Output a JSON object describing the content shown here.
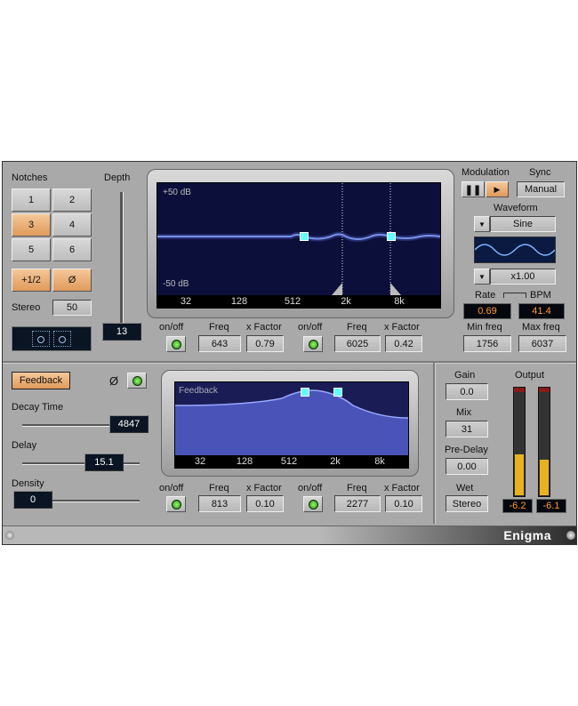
{
  "notches": {
    "label": "Notches",
    "buttons": [
      "1",
      "2",
      "3",
      "4",
      "5",
      "6"
    ],
    "selected": "3",
    "half_label": "+1/2",
    "phase_label": "Ø",
    "stereo_label": "Stereo",
    "stereo_value": "50"
  },
  "depth": {
    "label": "Depth",
    "value": "13"
  },
  "top_display": {
    "top_db": "+50 dB",
    "bottom_db": "-50 dB",
    "freq_ticks": [
      "32",
      "128",
      "512",
      "2k",
      "8k"
    ]
  },
  "top_controls": [
    {
      "onoff_label": "on/off",
      "freq_label": "Freq",
      "factor_label": "x Factor",
      "freq": "643",
      "factor": "0.79"
    },
    {
      "onoff_label": "on/off",
      "freq_label": "Freq",
      "factor_label": "x Factor",
      "freq": "6025",
      "factor": "0.42"
    }
  ],
  "modulation": {
    "label": "Modulation",
    "sync_label": "Sync",
    "sync_value": "Manual",
    "waveform_label": "Waveform",
    "waveform_value": "Sine",
    "multiplier": "x1.00",
    "rate_label": "Rate",
    "bpm_label": "BPM",
    "rate_value": "0.69",
    "bpm_value": "41.4",
    "min_freq_label": "Min freq",
    "max_freq_label": "Max freq",
    "min_freq": "1756",
    "max_freq": "6037"
  },
  "feedback": {
    "label": "Feedback",
    "phase_label": "Ø",
    "decay_label": "Decay Time",
    "decay_value": "4847",
    "delay_label": "Delay",
    "delay_value": "15.1",
    "density_label": "Density",
    "density_value": "0"
  },
  "bottom_display": {
    "label": "Feedback",
    "freq_ticks": [
      "32",
      "128",
      "512",
      "2k",
      "8k"
    ]
  },
  "bottom_controls": [
    {
      "onoff_label": "on/off",
      "freq_label": "Freq",
      "factor_label": "x Factor",
      "freq": "813",
      "factor": "0.10"
    },
    {
      "onoff_label": "on/off",
      "freq_label": "Freq",
      "factor_label": "x Factor",
      "freq": "2277",
      "factor": "0.10"
    }
  ],
  "mix_section": {
    "gain_label": "Gain",
    "gain_value": "0.0",
    "mix_label": "Mix",
    "mix_value": "31",
    "predelay_label": "Pre-Delay",
    "predelay_value": "0.00",
    "wet_label": "Wet",
    "wet_value": "Stereo"
  },
  "output": {
    "label": "Output",
    "left_value": "-6.2",
    "right_value": "-6.1",
    "left_level": 0.38,
    "right_level": 0.33
  },
  "footer": {
    "product_name": "Enigma"
  },
  "colors": {
    "panel": "#a9a9a9",
    "screen": "#0b0f3a",
    "curve": "#8fa8ff",
    "accent_orange": "#ff9933",
    "meter": "#e8b21e"
  }
}
